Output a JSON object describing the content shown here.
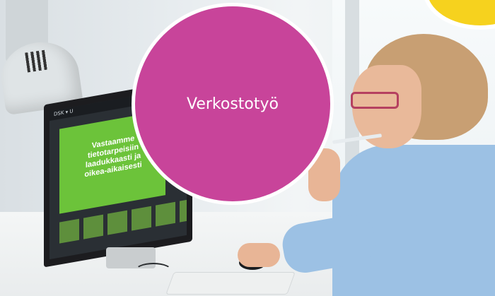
{
  "image": {
    "alt": "Woman with glasses looking at a monitor showing a green slide, with a pink circle label overlay"
  },
  "overlay": {
    "label": "Verkostotyö",
    "circle_color": "#c8449a",
    "badge_color": "#f6d21e"
  },
  "screen": {
    "app_title": "DSK ▾ U",
    "slide_text": "Vastaamme tietotarpeisiin laadukkaasti ja oikea-aikaisesti"
  }
}
